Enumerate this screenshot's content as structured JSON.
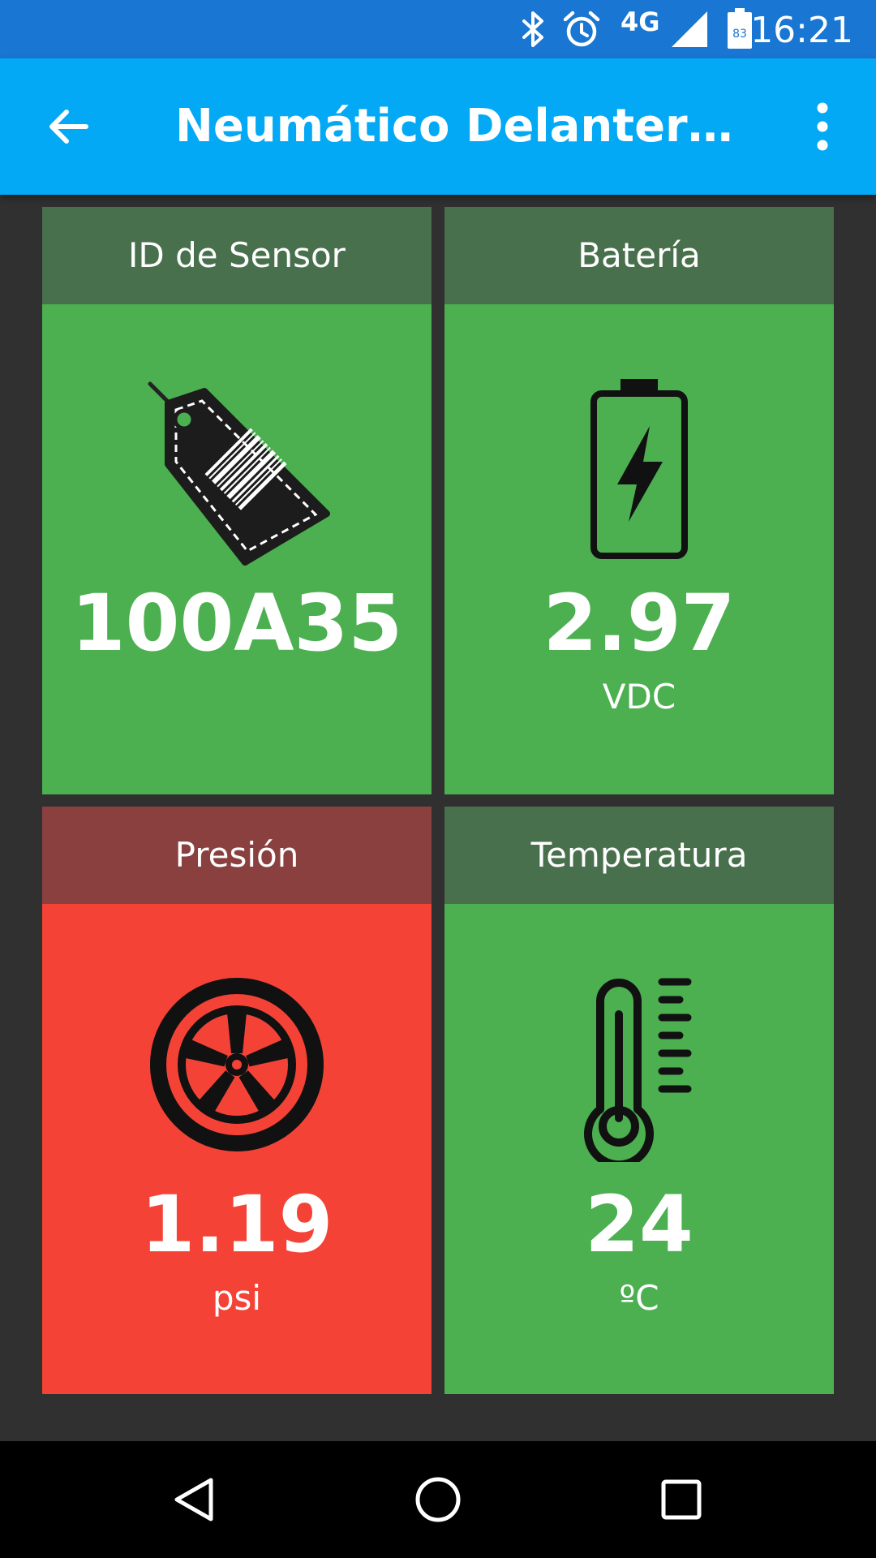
{
  "status_bar": {
    "network": "4G",
    "battery_level": "83",
    "time": "16:21",
    "icons": [
      "bluetooth-icon",
      "alarm-icon",
      "signal-icon",
      "battery-icon"
    ]
  },
  "app_bar": {
    "title": "Neumático Delantero Izquierdo",
    "icons": [
      "back-arrow-icon",
      "overflow-menu-icon"
    ]
  },
  "cards": {
    "sensor_id": {
      "title": "ID de Sensor",
      "value": "100A35",
      "icon": "barcode-tag-icon",
      "status": "ok"
    },
    "battery": {
      "title": "Batería",
      "value": "2.97",
      "unit": "VDC",
      "icon": "battery-charging-icon",
      "status": "ok"
    },
    "pressure": {
      "title": "Presión",
      "value": "1.19",
      "unit": "psi",
      "icon": "wheel-icon",
      "status": "alert"
    },
    "temperature": {
      "title": "Temperatura",
      "value": "24",
      "unit": "ºC",
      "icon": "thermometer-icon",
      "status": "ok"
    }
  },
  "colors": {
    "status_bar": "#1976d2",
    "app_bar": "#03a9f4",
    "ok_header": "#49704c",
    "ok_body": "#4caf50",
    "alert_header": "#8b4040",
    "alert_body": "#f44336",
    "background": "#303030"
  },
  "nav_bar": {
    "icons": [
      "nav-back-icon",
      "nav-home-icon",
      "nav-recents-icon"
    ]
  }
}
